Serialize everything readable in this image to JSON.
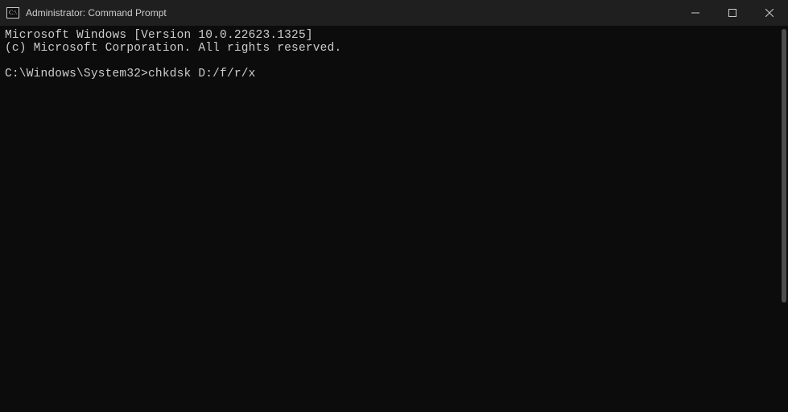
{
  "titlebar": {
    "title": "Administrator: Command Prompt"
  },
  "terminal": {
    "line1": "Microsoft Windows [Version 10.0.22623.1325]",
    "line2": "(c) Microsoft Corporation. All rights reserved.",
    "blank": "",
    "prompt": "C:\\Windows\\System32>",
    "command": "chkdsk D:/f/r/x"
  }
}
